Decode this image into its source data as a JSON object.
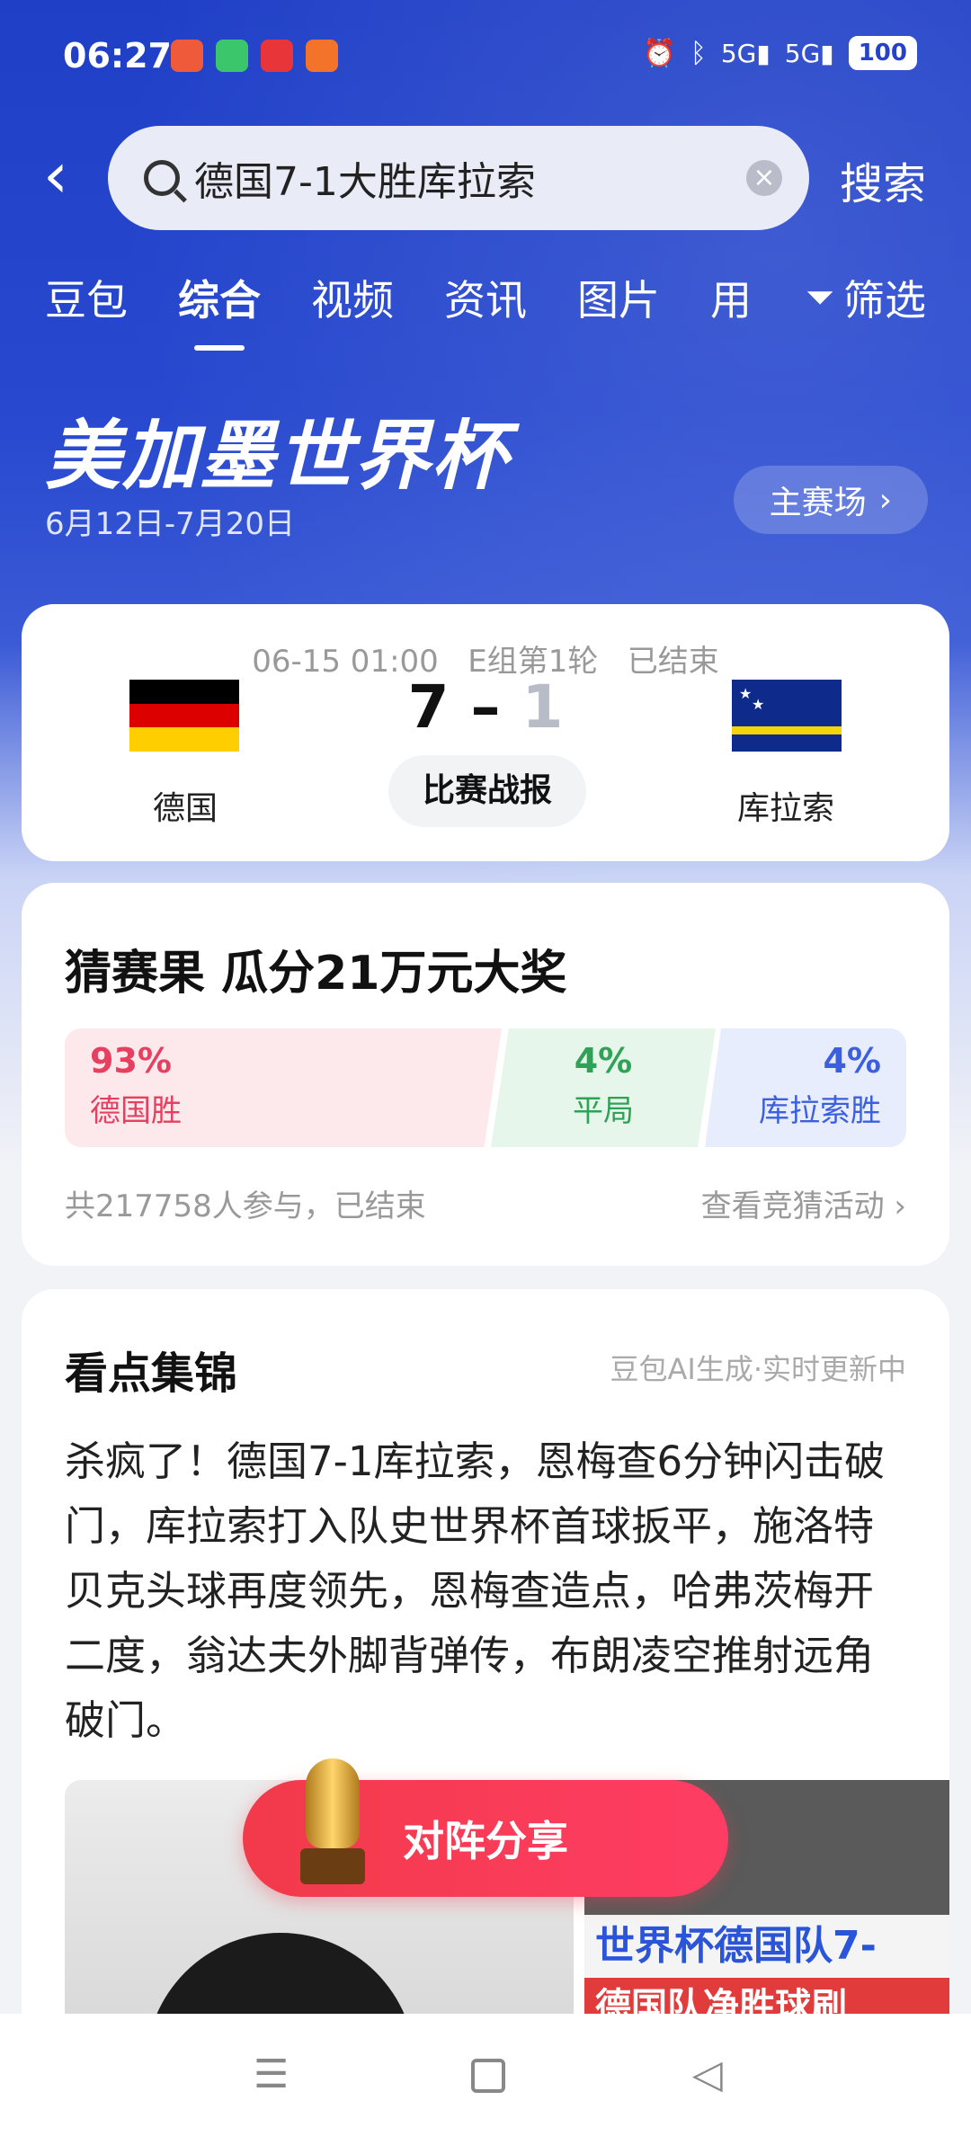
{
  "status_bar": {
    "time": "06:27",
    "network": "5G",
    "network2": "5G",
    "battery": "100"
  },
  "search": {
    "query": "德国7-1大胜库拉索",
    "button": "搜索"
  },
  "tabs": [
    {
      "label": "豆包"
    },
    {
      "label": "综合"
    },
    {
      "label": "视频"
    },
    {
      "label": "资讯"
    },
    {
      "label": "图片"
    },
    {
      "label": "用"
    }
  ],
  "filter": {
    "label": "筛选"
  },
  "banner": {
    "title": "美加墨世界杯",
    "dates": "6月12日-7月20日",
    "main_venue": "主赛场"
  },
  "match": {
    "datetime": "06-15 01:00",
    "round": "E组第1轮",
    "status": "已结束",
    "home_team": "德国",
    "away_team": "库拉索",
    "home_score": "7",
    "away_score": "1",
    "report_button": "比赛战报",
    "colors": {
      "de_black": "#000000",
      "de_red": "#dd0000",
      "de_gold": "#ffce00",
      "cw_blue": "#0e2a8a",
      "cw_yellow": "#f5d40a"
    }
  },
  "guess": {
    "title": "猜赛果 瓜分21万元大奖",
    "home_pct": "93%",
    "home_label": "德国胜",
    "draw_pct": "4%",
    "draw_label": "平局",
    "away_pct": "4%",
    "away_label": "库拉索胜",
    "participants": "共217758人参与，已结束",
    "link": "查看竞猜活动"
  },
  "highlights": {
    "title": "看点集锦",
    "subtitle": "豆包AI生成·实时更新中",
    "text": "杀疯了！德国7-1库拉索，恩梅查6分钟闪击破门，库拉索打入队史世界杯首球扳平，施洛特贝克头球再度领先，恩梅查造点，哈弗茨梅开二度，翁达夫外脚背弹传，布朗凌空推射远角破门。",
    "thumb2_caption1": "世界杯德国队7-",
    "thumb2_caption2": "德国队净胜球刷"
  },
  "share": {
    "label": "对阵分享"
  }
}
